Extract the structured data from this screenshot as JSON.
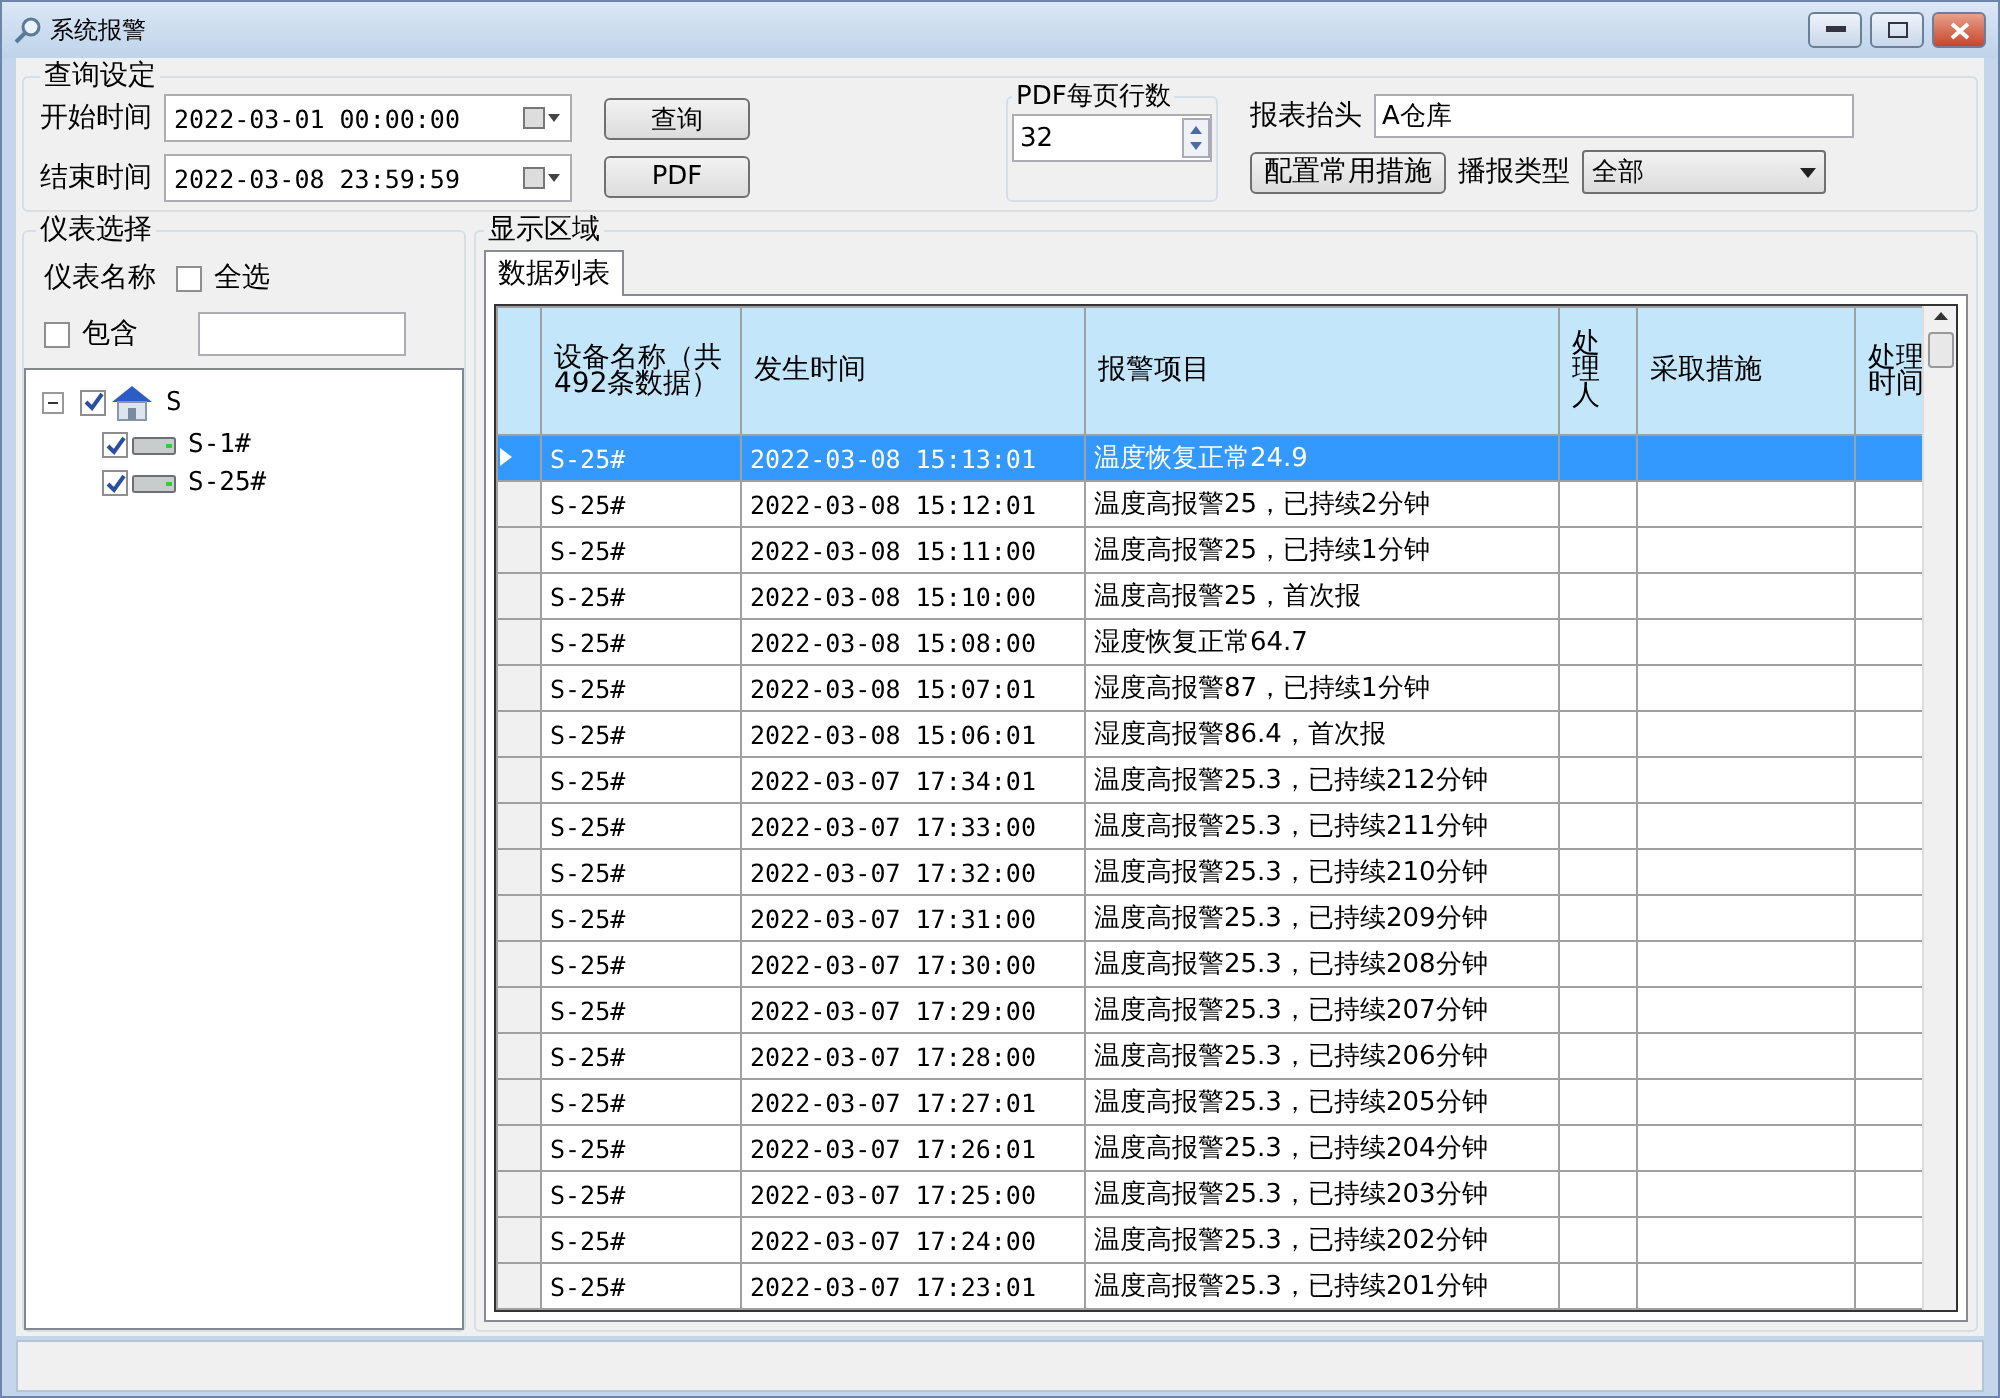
{
  "window": {
    "title": "系统报警"
  },
  "query": {
    "title": "查询设定",
    "start_label": "开始时间",
    "start_value": "2022-03-01 00:00:00",
    "end_label": "结束时间",
    "end_value": "2022-03-08 23:59:59",
    "query_button": "查询",
    "pdf_button": "PDF",
    "pdf_rows_label": "PDF每页行数",
    "pdf_rows_value": "32",
    "header_label": "报表抬头",
    "header_value": "A仓库",
    "measures_button": "配置常用措施",
    "type_label": "播报类型",
    "type_value": "全部"
  },
  "meter_select": {
    "title": "仪表选择",
    "name_label": "仪表名称",
    "select_all": {
      "label": "全选",
      "checked": false
    },
    "contains": {
      "label": "包含",
      "checked": false
    },
    "tree": [
      {
        "label": "S",
        "kind": "site",
        "checked": true,
        "expanded": true,
        "children": [
          {
            "label": "S-1#",
            "kind": "device",
            "checked": true
          },
          {
            "label": "S-25#",
            "kind": "device",
            "checked": true
          }
        ]
      }
    ]
  },
  "display": {
    "title": "显示区域",
    "tabs": [
      {
        "label": "数据列表",
        "selected": true
      }
    ],
    "columns": [
      "设备名称（共492条数据）",
      "发生时间",
      "报警项目",
      "处理人",
      "采取措施",
      "处理时间"
    ],
    "rows": [
      {
        "name": "S-25#",
        "time": "2022-03-08 15:13:01",
        "item": "温度恢复正常24.9",
        "selected": true
      },
      {
        "name": "S-25#",
        "time": "2022-03-08 15:12:01",
        "item": "温度高报警25，已持续2分钟",
        "selected": false
      },
      {
        "name": "S-25#",
        "time": "2022-03-08 15:11:00",
        "item": "温度高报警25，已持续1分钟",
        "selected": false
      },
      {
        "name": "S-25#",
        "time": "2022-03-08 15:10:00",
        "item": "温度高报警25，首次报",
        "selected": false
      },
      {
        "name": "S-25#",
        "time": "2022-03-08 15:08:00",
        "item": "湿度恢复正常64.7",
        "selected": false
      },
      {
        "name": "S-25#",
        "time": "2022-03-08 15:07:01",
        "item": "湿度高报警87，已持续1分钟",
        "selected": false
      },
      {
        "name": "S-25#",
        "time": "2022-03-08 15:06:01",
        "item": "湿度高报警86.4，首次报",
        "selected": false
      },
      {
        "name": "S-25#",
        "time": "2022-03-07 17:34:01",
        "item": "温度高报警25.3，已持续212分钟",
        "selected": false
      },
      {
        "name": "S-25#",
        "time": "2022-03-07 17:33:00",
        "item": "温度高报警25.3，已持续211分钟",
        "selected": false
      },
      {
        "name": "S-25#",
        "time": "2022-03-07 17:32:00",
        "item": "温度高报警25.3，已持续210分钟",
        "selected": false
      },
      {
        "name": "S-25#",
        "time": "2022-03-07 17:31:00",
        "item": "温度高报警25.3，已持续209分钟",
        "selected": false
      },
      {
        "name": "S-25#",
        "time": "2022-03-07 17:30:00",
        "item": "温度高报警25.3，已持续208分钟",
        "selected": false
      },
      {
        "name": "S-25#",
        "time": "2022-03-07 17:29:00",
        "item": "温度高报警25.3，已持续207分钟",
        "selected": false
      },
      {
        "name": "S-25#",
        "time": "2022-03-07 17:28:00",
        "item": "温度高报警25.3，已持续206分钟",
        "selected": false
      },
      {
        "name": "S-25#",
        "time": "2022-03-07 17:27:01",
        "item": "温度高报警25.3，已持续205分钟",
        "selected": false
      },
      {
        "name": "S-25#",
        "time": "2022-03-07 17:26:01",
        "item": "温度高报警25.3，已持续204分钟",
        "selected": false
      },
      {
        "name": "S-25#",
        "time": "2022-03-07 17:25:00",
        "item": "温度高报警25.3，已持续203分钟",
        "selected": false
      },
      {
        "name": "S-25#",
        "time": "2022-03-07 17:24:00",
        "item": "温度高报警25.3，已持续202分钟",
        "selected": false
      },
      {
        "name": "S-25#",
        "time": "2022-03-07 17:23:01",
        "item": "温度高报警25.3，已持续201分钟",
        "selected": false
      }
    ]
  }
}
